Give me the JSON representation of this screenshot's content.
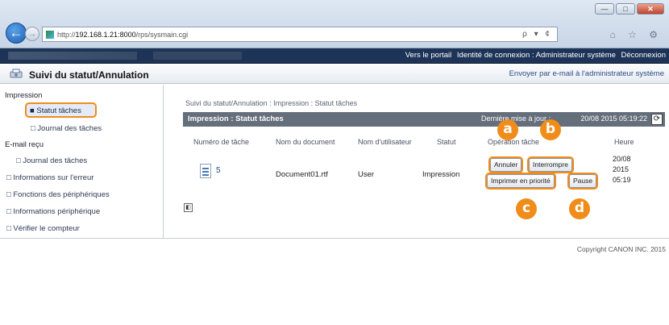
{
  "browser": {
    "url_prefix": "http://",
    "url_host": "192.168.1.21:8000",
    "url_path": "/rps/sysmain.cgi",
    "address_tools": "ρ ▾ ¢",
    "window_min": "—",
    "window_max": "□",
    "window_close": "✕",
    "tab_icons": "⌂ ☆ ⚙"
  },
  "topbar": {
    "portal_link": "Vers le portail",
    "login_identity": "Identité de connexion : Administrateur système",
    "logout_link": "Déconnexion"
  },
  "header": {
    "title": "Suivi du statut/Annulation",
    "email_link": "Envoyer par e-mail à l'administrateur système"
  },
  "sidebar": {
    "section_print": "Impression",
    "item_job_status": "Statut tâches",
    "item_job_log": "□ Journal des tâches",
    "section_fax": "E-mail reçu",
    "item_fax_log": "□ Journal des tâches",
    "item_error_info": "□ Informations sur l'erreur",
    "item_device_functions": "□ Fonctions des périphériques",
    "item_device_info": "□ Informations périphérique",
    "item_counter": "□ Vérifier le compteur"
  },
  "main": {
    "breadcrumb": "Suivi du statut/Annulation : Impression : Statut tâches",
    "panel_title": "Impression : Statut tâches",
    "panel_date_prefix": "Dernière mise à jour :",
    "panel_date": "20/08 2015 05:19:22",
    "refresh_icon": "⟳",
    "columns": {
      "job_number": "Numéro de tâche",
      "doc_name": "Nom du document",
      "user_name": "Nom d'utilisateur",
      "status": "Statut",
      "operation": "Opération tâche",
      "time": "Heure"
    },
    "row": {
      "job_number": "5",
      "doc_name": "Document01.rtf",
      "user_name": "User",
      "status": "Impression",
      "time_line1": "20/08",
      "time_line2": "2015",
      "time_line3": "05:19"
    },
    "buttons": {
      "cancel": "Annuler",
      "interrupt": "Interrompre",
      "print_priority": "Imprimer en priorité",
      "pause": "Pause"
    },
    "badges": {
      "a": "a",
      "b": "b",
      "c": "c",
      "d": "d"
    },
    "pager_icon": "◧",
    "copyright": "Copyright CANON INC. 2015"
  },
  "colors": {
    "accent_orange": "#f08c1a",
    "topbar_navy": "#1d3458",
    "panel_gray": "#656e7b"
  }
}
